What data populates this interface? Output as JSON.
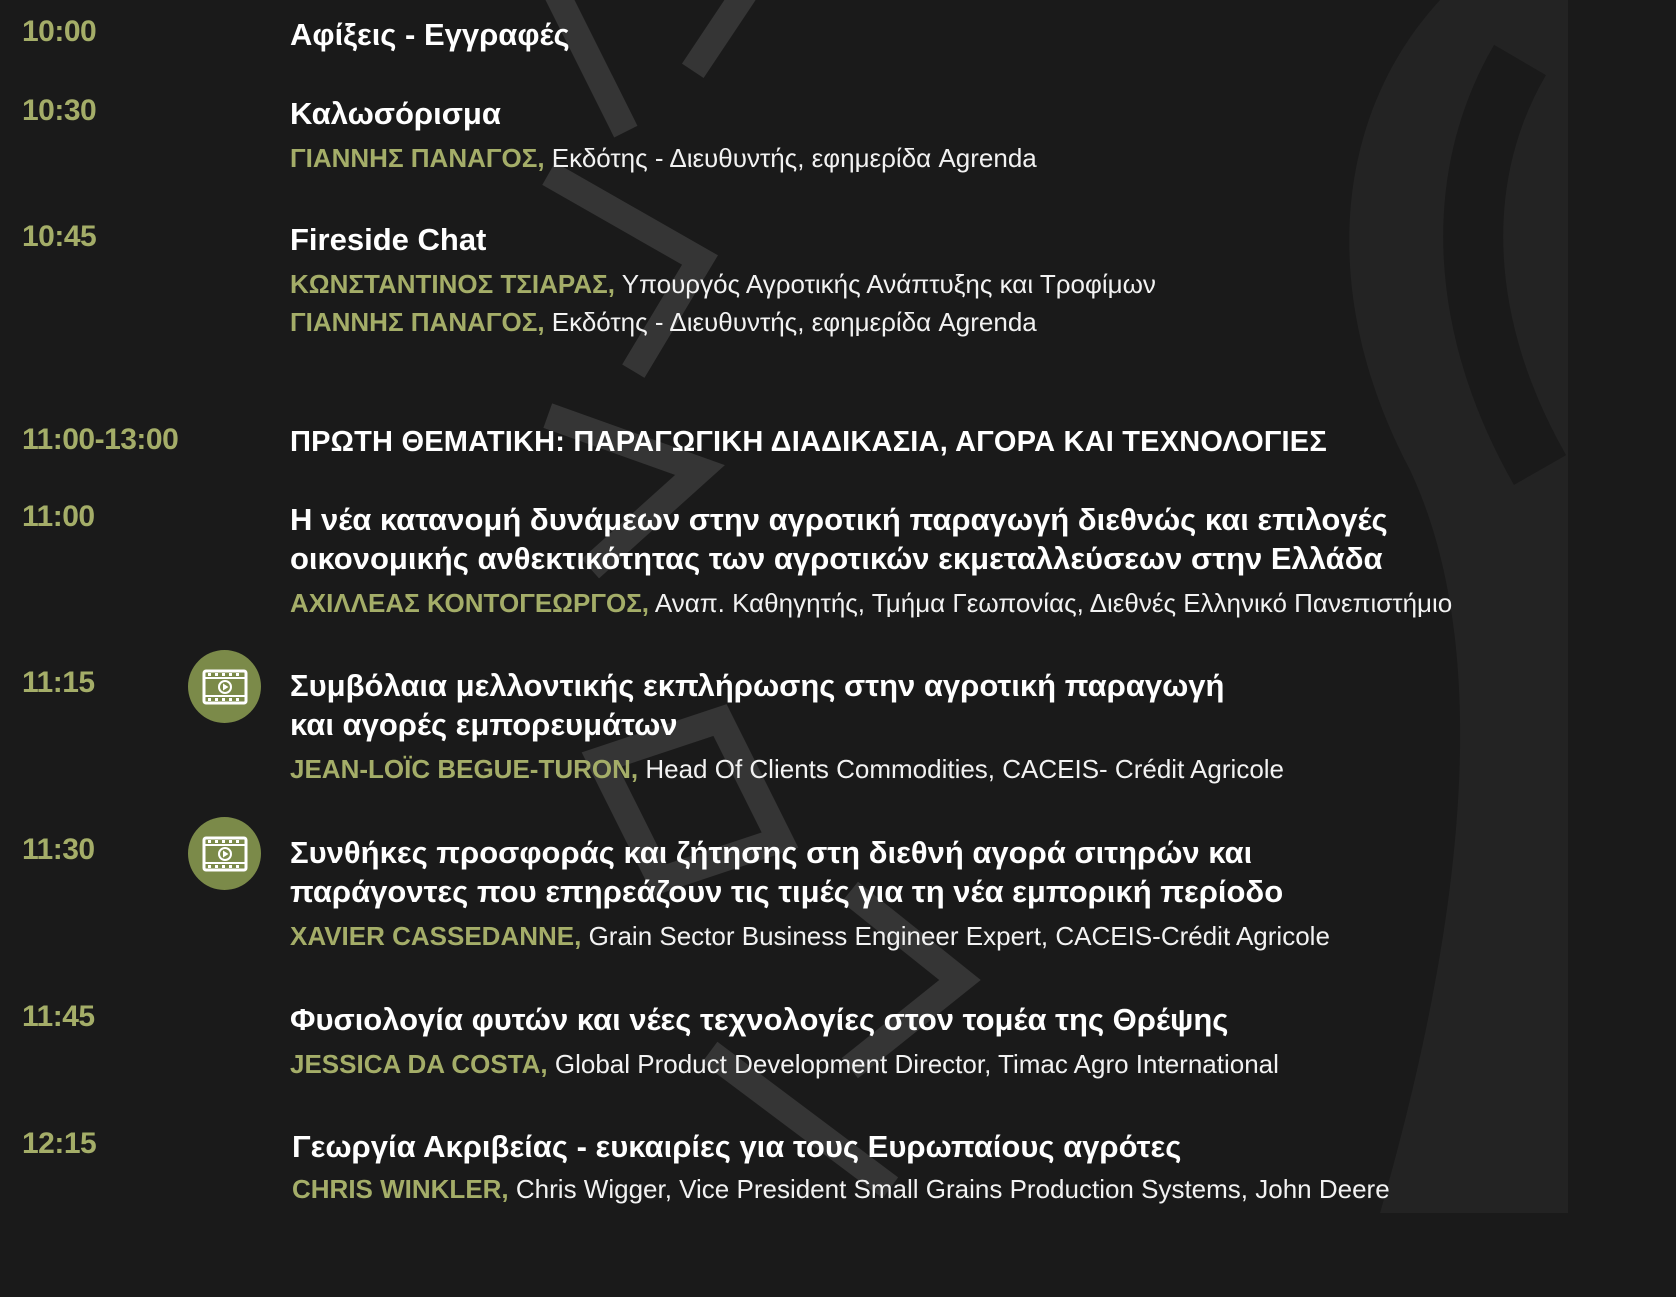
{
  "colors": {
    "background": "#1a1a1a",
    "accent": "#a4ad68",
    "badge": "#7b8a49",
    "text": "#ffffff"
  },
  "agenda": [
    {
      "time": "10:00",
      "title_lines": [
        "Αφίξεις - Εγγραφές"
      ],
      "speakers": []
    },
    {
      "time": "10:30",
      "title_lines": [
        "Καλωσόρισμα"
      ],
      "speakers": [
        {
          "name": "ΓΙΑΝΝΗΣ ΠΑΝΑΓΟΣ,",
          "role": " Εκδότης - Διευθυντής, εφημερίδα Agrenda"
        }
      ]
    },
    {
      "time": "10:45",
      "title_lines": [
        "Fireside Chat"
      ],
      "speakers": [
        {
          "name": "ΚΩΝΣΤΑΝΤΙΝΟΣ ΤΣΙΑΡΑΣ,",
          "role": " Υπουργός Αγροτικής Ανάπτυξης και Τροφίμων"
        },
        {
          "name": "ΓΙΑΝΝΗΣ ΠΑΝΑΓΟΣ,",
          "role": " Εκδότης - Διευθυντής, εφημερίδα Agrenda"
        }
      ]
    },
    {
      "time": "11:00-13:00",
      "title_lines": [
        "ΠΡΩΤΗ ΘΕΜΑΤΙΚΗ: ΠΑΡΑΓΩΓΙΚΗ ΔΙΑΔΙΚΑΣΙΑ, ΑΓΟΡΑ ΚΑΙ ΤΕΧΝΟΛΟΓΙΕΣ"
      ],
      "speakers": []
    },
    {
      "time": "11:00",
      "title_lines": [
        "Η νέα κατανομή δυνάμεων στην αγροτική παραγωγή διεθνώς και επιλογές",
        "οικονομικής ανθεκτικότητας των αγροτικών εκμεταλλεύσεων στην Ελλάδα"
      ],
      "speakers": [
        {
          "name": "ΑΧΙΛΛΕΑΣ ΚΟΝΤΟΓΕΩΡΓΟΣ,",
          "role": " Αναπ. Καθηγητής, Τμήμα Γεωπονίας, Διεθνές Ελληνικό Πανεπιστήμιο"
        }
      ]
    },
    {
      "time": "11:15",
      "video_icon": "film-play-icon",
      "title_lines": [
        "Συμβόλαια μελλοντικής εκπλήρωσης στην αγροτική παραγωγή",
        "και αγορές εμπορευμάτων"
      ],
      "speakers": [
        {
          "name": "JEAN-LOÏC BEGUE-TURON,",
          "role": " Head Of Clients Commodities, CACEIS- Crédit Agricole"
        }
      ]
    },
    {
      "time": "11:30",
      "video_icon": "film-play-icon",
      "title_lines": [
        "Συνθήκες προσφοράς και ζήτησης στη διεθνή αγορά σιτηρών και",
        "παράγοντες που επηρεάζουν τις τιμές για τη νέα εμπορική περίοδο"
      ],
      "speakers": [
        {
          "name": "XAVIER CASSEDANNE,",
          "role": " Grain Sector Business Engineer Expert, CACEIS-Crédit Agricole"
        }
      ]
    },
    {
      "time": "11:45",
      "title_lines": [
        "Φυσιολογία φυτών και νέες τεχνολογίες στον τομέα της Θρέψης"
      ],
      "speakers": [
        {
          "name": "JESSICA DA COSTA,",
          "role": " Global Product Development Director, Timac Agro International"
        }
      ]
    },
    {
      "time": "12:15",
      "title_lines": [
        "Γεωργία Ακριβείας - ευκαιρίες για τους Ευρωπαίους αγρότες"
      ],
      "speakers": [
        {
          "name": "CHRIS WINKLER,",
          "role": " Chris Wigger, Vice President Small Grains Production Systems, John Deere"
        }
      ]
    }
  ]
}
